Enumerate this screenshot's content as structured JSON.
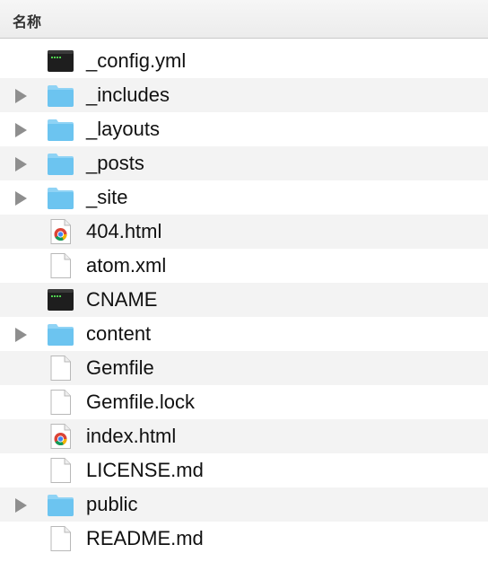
{
  "header": {
    "name_column": "名称"
  },
  "files": [
    {
      "name": "_config.yml",
      "kind": "terminal",
      "expandable": false
    },
    {
      "name": "_includes",
      "kind": "folder",
      "expandable": true
    },
    {
      "name": "_layouts",
      "kind": "folder",
      "expandable": true
    },
    {
      "name": "_posts",
      "kind": "folder",
      "expandable": true
    },
    {
      "name": "_site",
      "kind": "folder",
      "expandable": true
    },
    {
      "name": "404.html",
      "kind": "chrome-html",
      "expandable": false
    },
    {
      "name": "atom.xml",
      "kind": "document",
      "expandable": false
    },
    {
      "name": "CNAME",
      "kind": "terminal",
      "expandable": false
    },
    {
      "name": "content",
      "kind": "folder",
      "expandable": true
    },
    {
      "name": "Gemfile",
      "kind": "document",
      "expandable": false
    },
    {
      "name": "Gemfile.lock",
      "kind": "document",
      "expandable": false
    },
    {
      "name": "index.html",
      "kind": "chrome-html",
      "expandable": false
    },
    {
      "name": "LICENSE.md",
      "kind": "document",
      "expandable": false
    },
    {
      "name": "public",
      "kind": "folder",
      "expandable": true
    },
    {
      "name": "README.md",
      "kind": "document",
      "expandable": false
    }
  ],
  "icon_names": {
    "folder": "folder-icon",
    "terminal": "terminal-file-icon",
    "document": "document-icon",
    "chrome-html": "chrome-html-icon"
  },
  "colors": {
    "folder": "#6cc4f0",
    "folder_tab": "#8fd3f5",
    "stripe": "#f3f3f3",
    "disclosure": "#8e8e8e"
  }
}
